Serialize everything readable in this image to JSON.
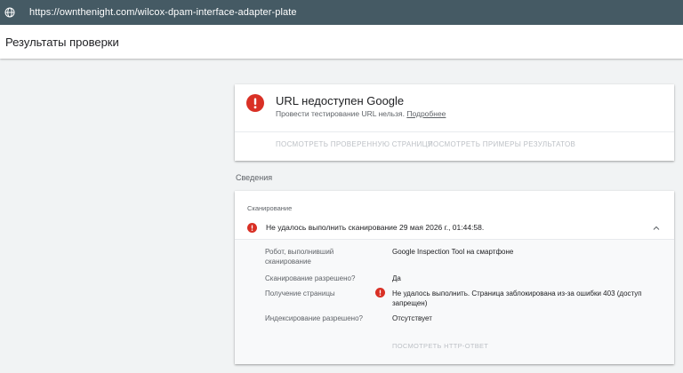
{
  "browser": {
    "url": "https://ownthenight.com/wilcox-dpam-interface-adapter-plate",
    "icon": "globe-icon"
  },
  "header": {
    "title": "Результаты проверки"
  },
  "status_card": {
    "icon": "error-icon",
    "headline": "URL недоступен Google",
    "subtext": "Провести тестирование URL нельзя.",
    "link": "Подробнее",
    "button_view_page": "ПОСМОТРЕТЬ ПРОВЕРЕННУЮ СТРАНИЦУ",
    "button_view_results": "ПОСМОТРЕТЬ ПРИМЕРЫ РЕЗУЛЬТАТОВ"
  },
  "details": {
    "section_label": "Сведения",
    "category": "Сканирование",
    "summary": "Не удалось выполнить сканирование 29 мая 2026 г., 01:44:58.",
    "rows": [
      {
        "label": "Робот, выполнивший сканирование",
        "value": "Google Inspection Tool на смартфоне"
      },
      {
        "label": "Сканирование разрешено?",
        "value": "Да"
      },
      {
        "label": "Получение страницы",
        "value": "Не удалось выполнить. Страница заблокирована из-за ошибки 403 (доступ запрещен)"
      },
      {
        "label": "Индексирование разрешено?",
        "value": "Отсутствует"
      }
    ],
    "http_button": "ПОСМОТРЕТЬ HTTP-ОТВЕТ"
  },
  "colors": {
    "urlbar_bg": "#455a64",
    "error_red": "#d93025",
    "disabled_text": "#bdc1c6"
  }
}
